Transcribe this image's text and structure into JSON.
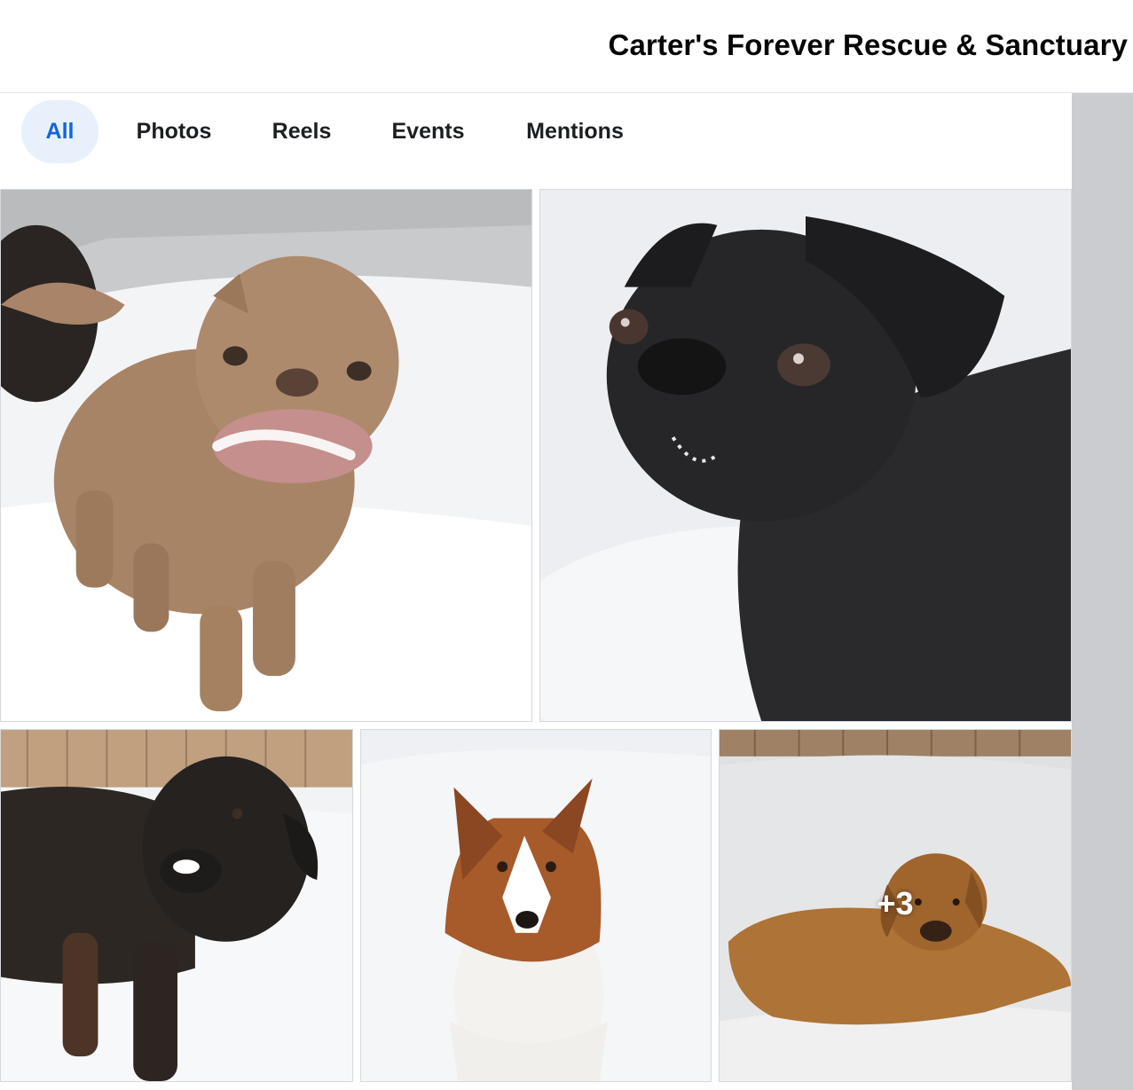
{
  "header": {
    "title": "Carter's Forever Rescue & Sanctuary"
  },
  "tabs": [
    {
      "label": "All",
      "active": true
    },
    {
      "label": "Photos",
      "active": false
    },
    {
      "label": "Reels",
      "active": false
    },
    {
      "label": "Events",
      "active": false
    },
    {
      "label": "Mentions",
      "active": false
    }
  ],
  "photos": [
    {
      "subject": "tan bulldog with snow on its muzzle"
    },
    {
      "subject": "black pug in the snow"
    },
    {
      "subject": "black and brown large dog with snow on nose"
    },
    {
      "subject": "sable and white sheltie sitting in snow"
    },
    {
      "subject": "golden retriever lying in snow",
      "overlay": "+3"
    }
  ],
  "colors": {
    "accent": "#1466d6",
    "active_tab_bg": "#e7f0fb",
    "scrollbar_track": "#cbccd0"
  }
}
